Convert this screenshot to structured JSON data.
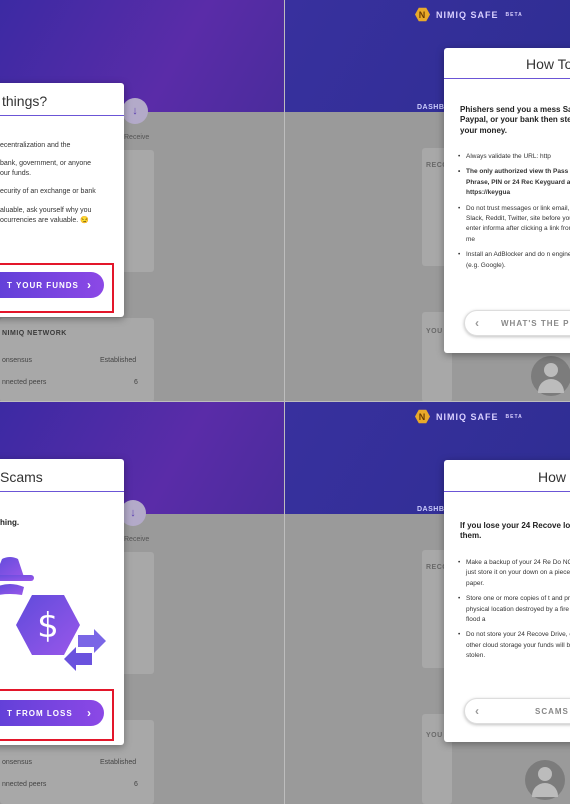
{
  "app": {
    "brand": "NIMIQ SAFE",
    "brand_sup": "BETA",
    "brand_letter": "N"
  },
  "bg": {
    "receive": "Receive",
    "dashboard": "DASHB",
    "reco": "RECO",
    "you": "YOU",
    "network_title": "NIMIQ NETWORK",
    "consensus_label": "onsensus",
    "consensus_value": "Established",
    "peers_label": "nnected peers",
    "peers_value": "6"
  },
  "panel_tl": {
    "title": "things?",
    "lines": [
      "ecentralization and the",
      "",
      "bank, government, or anyone",
      "our funds.",
      "",
      "ecurity of an exchange or bank",
      "",
      "aluable, ask yourself why you",
      "ocurrencies are valuable. 😏"
    ],
    "button_label": "T YOUR FUNDS"
  },
  "panel_tr": {
    "title": "How To",
    "intro": "Phishers send you a mess Safe, Paypal, or your bank then steal your money.",
    "bullets": [
      "Always validate the URL: http",
      "The only authorized view th Pass Phrase, PIN or 24 Rec Keyguard at https://keygua",
      "Do not trust messages or link email, Slack, Reddit, Twitter, site before you enter informa after clicking a link from a me",
      "Install an AdBlocker and do n engine (e.g. Google)."
    ],
    "button_label": "WHAT'S THE P"
  },
  "panel_bl": {
    "title": "Scams",
    "subtitle": "hing.",
    "button_label": "T FROM LOSS"
  },
  "panel_br": {
    "title": "How",
    "intro": "If you lose your 24 Recove lose them.",
    "bullets": [
      "Make a backup of your 24 Re Do NOT just store it on your down on a piece of paper.",
      "Store one or more copies of t and private physical location destroyed by a fire or flood a",
      "Do not store your 24 Recove Drive, or other cloud storage your funds will be stolen."
    ],
    "button_label": "SCAMS"
  },
  "colors": {
    "accent": "#6b55d6",
    "highlight": "#e3162a",
    "brand_gold": "#e9a92a"
  }
}
